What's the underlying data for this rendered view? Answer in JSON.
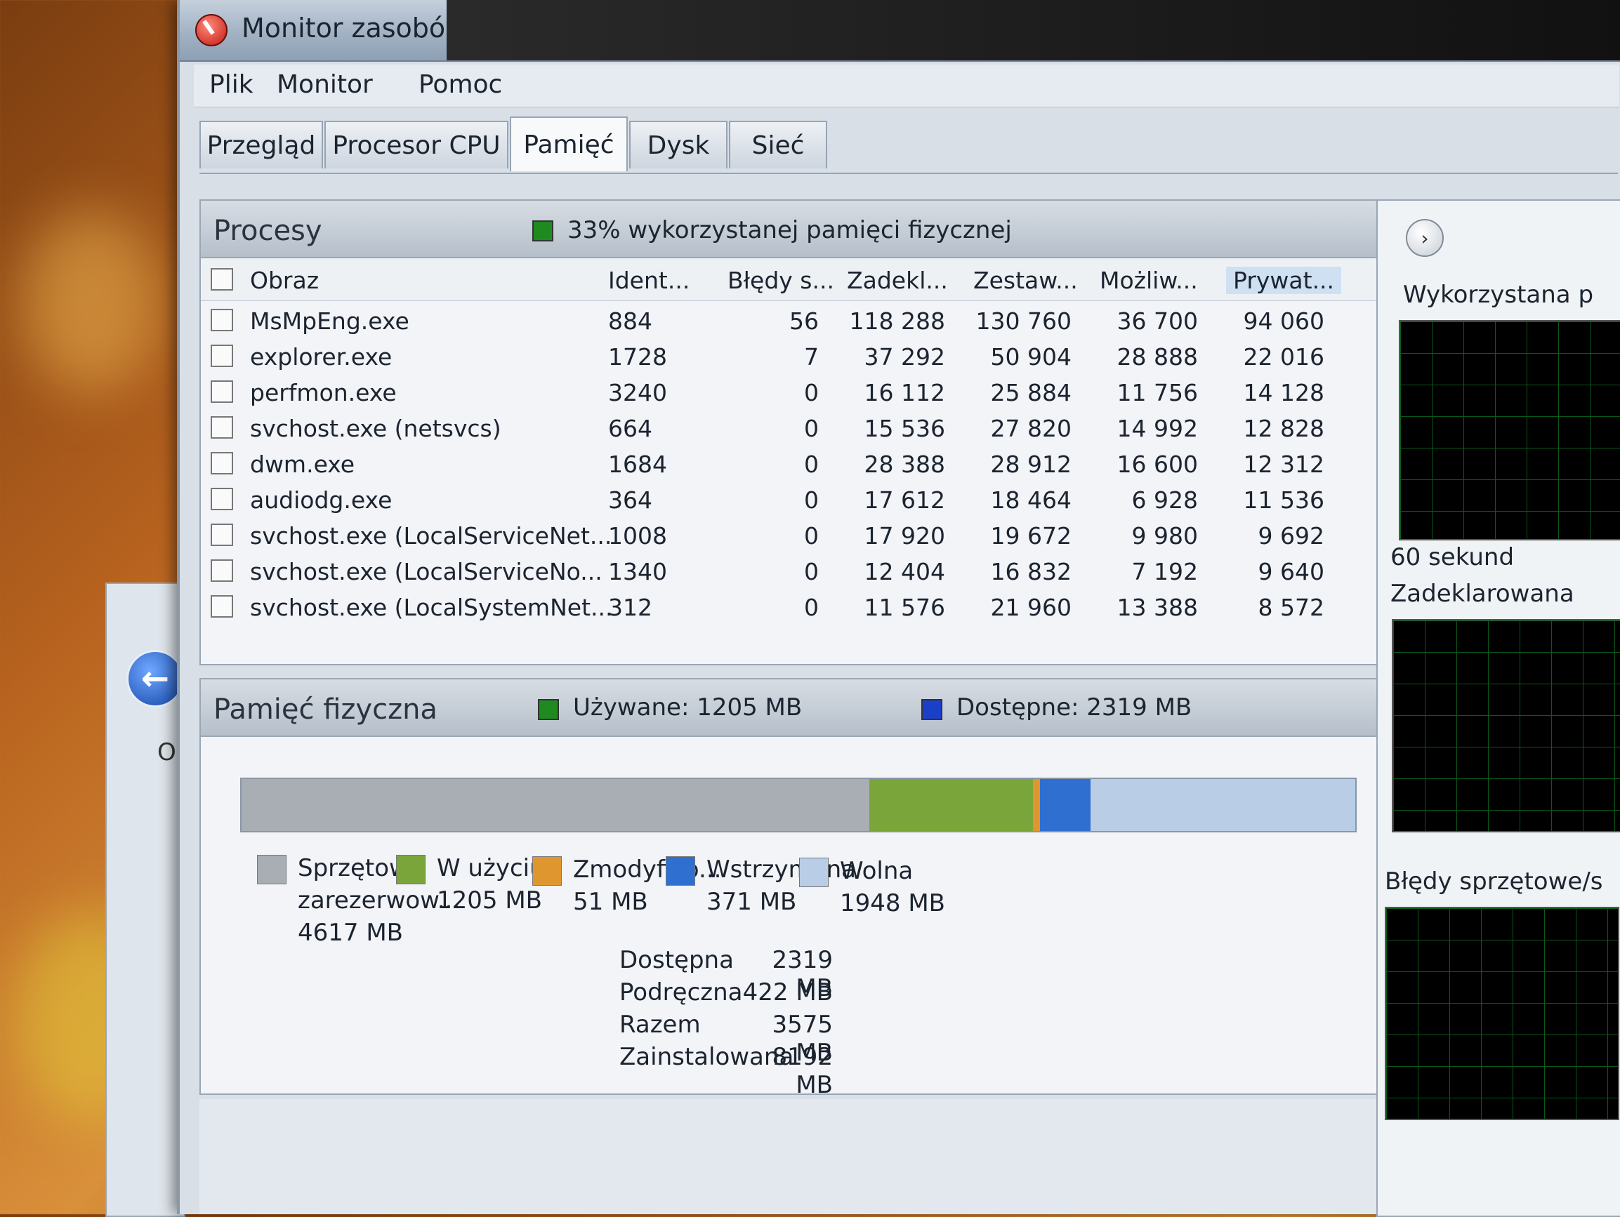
{
  "window": {
    "title": "Monitor zasobów"
  },
  "menu": [
    "Plik",
    "Monitor",
    "Pomoc"
  ],
  "tabs": [
    "Przegląd",
    "Procesor CPU",
    "Pamięć",
    "Dysk",
    "Sieć"
  ],
  "processes": {
    "title": "Procesy",
    "summary": "33% wykorzystanej pamięci fizycznej",
    "columns": [
      "Obraz",
      "Ident...",
      "Błędy s...",
      "Zadekl...",
      "Zestaw...",
      "Możliw...",
      "Prywat..."
    ],
    "rows": [
      [
        "MsMpEng.exe",
        "884",
        "56",
        "118 288",
        "130 760",
        "36 700",
        "94 060"
      ],
      [
        "explorer.exe",
        "1728",
        "7",
        "37 292",
        "50 904",
        "28 888",
        "22 016"
      ],
      [
        "perfmon.exe",
        "3240",
        "0",
        "16 112",
        "25 884",
        "11 756",
        "14 128"
      ],
      [
        "svchost.exe (netsvcs)",
        "664",
        "0",
        "15 536",
        "27 820",
        "14 992",
        "12 828"
      ],
      [
        "dwm.exe",
        "1684",
        "0",
        "28 388",
        "28 912",
        "16 600",
        "12 312"
      ],
      [
        "audiodg.exe",
        "364",
        "0",
        "17 612",
        "18 464",
        "6 928",
        "11 536"
      ],
      [
        "svchost.exe (LocalServiceNet...",
        "1008",
        "0",
        "17 920",
        "19 672",
        "9 980",
        "9 692"
      ],
      [
        "svchost.exe (LocalServiceNo...",
        "1340",
        "0",
        "12 404",
        "16 832",
        "7 192",
        "9 640"
      ],
      [
        "svchost.exe (LocalSystemNet...",
        "312",
        "0",
        "11 576",
        "21 960",
        "13 388",
        "8 572"
      ]
    ]
  },
  "physical_memory": {
    "title": "Pamięć fizyczna",
    "used_label": "Używane: 1205 MB",
    "available_label": "Dostępne: 2319 MB",
    "bar_mb": {
      "hardware": 4617,
      "in_use": 1205,
      "modified": 51,
      "standby": 371,
      "free": 1948
    },
    "legend": [
      {
        "label": "Sprzętowa",
        "label2": "zarezerwow...",
        "value": "4617 MB",
        "color": "#a9aeb4"
      },
      {
        "label": "W użyciu",
        "value": "1205 MB",
        "color": "#7aa53a"
      },
      {
        "label": "Zmodyfiko...",
        "value": "51 MB",
        "color": "#e0962e"
      },
      {
        "label": "Wstrzymana",
        "value": "371 MB",
        "color": "#2f6fd0"
      },
      {
        "label": "Wolna",
        "value": "1948 MB",
        "color": "#b9cde6"
      }
    ],
    "stats": [
      {
        "label": "Dostępna",
        "value": "2319 MB"
      },
      {
        "label": "Podręczna",
        "value": "422 MB"
      },
      {
        "label": "Razem",
        "value": "3575 MB"
      },
      {
        "label": "Zainstalowana",
        "value": "8192 MB"
      }
    ],
    "colors": {
      "used": "#1f8a1f",
      "available": "#1a3fc9"
    }
  },
  "side": {
    "graph1_label": "Wykorzystana p",
    "time_label": "60 sekund",
    "graph2_label": "Zadeklarowana",
    "graph3_label": "Błędy sprzętowe/s"
  },
  "behind_window_text": "O"
}
